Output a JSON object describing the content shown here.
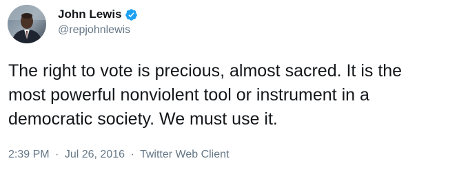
{
  "author": {
    "display_name": "John Lewis",
    "handle": "@repjohnlewis",
    "verified_icon": "verified-badge-icon",
    "verified_color": "#1da1f2"
  },
  "tweet": {
    "lines": [
      "The right to vote is precious, almost sacred. It is the",
      "most powerful nonviolent tool or instrument in a",
      "democratic society. We must use it."
    ]
  },
  "meta": {
    "time": "2:39 PM",
    "separator": "·",
    "date": "Jul 26, 2016",
    "client": "Twitter Web Client"
  }
}
